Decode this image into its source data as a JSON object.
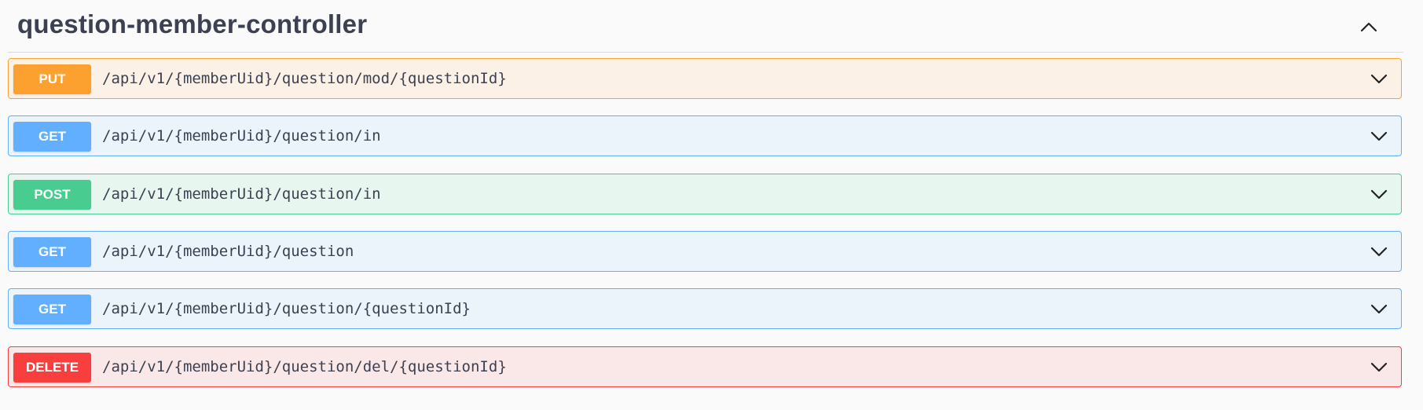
{
  "section": {
    "title": "question-member-controller",
    "collapse_icon": "chevron-up-icon"
  },
  "operations": [
    {
      "method": "PUT",
      "path": "/api/v1/{memberUid}/question/mod/{questionId}",
      "color": "#fca130"
    },
    {
      "method": "GET",
      "path": "/api/v1/{memberUid}/question/in",
      "color": "#61affe"
    },
    {
      "method": "POST",
      "path": "/api/v1/{memberUid}/question/in",
      "color": "#49cc90"
    },
    {
      "method": "GET",
      "path": "/api/v1/{memberUid}/question",
      "color": "#61affe"
    },
    {
      "method": "GET",
      "path": "/api/v1/{memberUid}/question/{questionId}",
      "color": "#61affe"
    },
    {
      "method": "DELETE",
      "path": "/api/v1/{memberUid}/question/del/{questionId}",
      "color": "#f93e3e"
    }
  ],
  "expand_icon": "chevron-down-icon"
}
